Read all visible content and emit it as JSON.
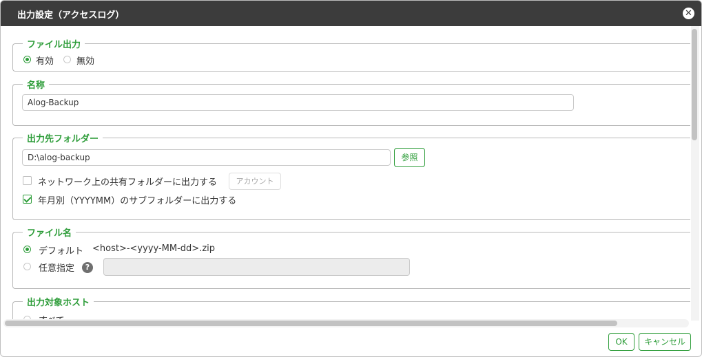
{
  "dialog": {
    "title": "出力設定（アクセスログ）",
    "close_icon": "close-icon"
  },
  "file_output": {
    "legend": "ファイル出力",
    "enabled_label": "有効",
    "disabled_label": "無効",
    "selected": "有効"
  },
  "name": {
    "legend": "名称",
    "value": "Alog-Backup"
  },
  "folder": {
    "legend": "出力先フォルダー",
    "path": "D:\\alog-backup",
    "browse_label": "参照",
    "network_share_label": "ネットワーク上の共有フォルダーに出力する",
    "network_share_checked": false,
    "account_label": "アカウント",
    "subfolder_label": "年月別（YYYYMM）のサブフォルダーに出力する",
    "subfolder_checked": true
  },
  "file_name": {
    "legend": "ファイル名",
    "default_label": "デフォルト",
    "default_pattern": "<host>-<yyyy-MM-dd>.zip",
    "custom_label": "任意指定",
    "custom_value": "",
    "selected": "デフォルト"
  },
  "target_host": {
    "legend": "出力対象ホスト",
    "first_option": "すべて"
  },
  "footer": {
    "ok_label": "OK",
    "cancel_label": "キャンセル"
  },
  "colors": {
    "accent": "#2e9d3a",
    "titlebar": "#3c3c3c"
  }
}
